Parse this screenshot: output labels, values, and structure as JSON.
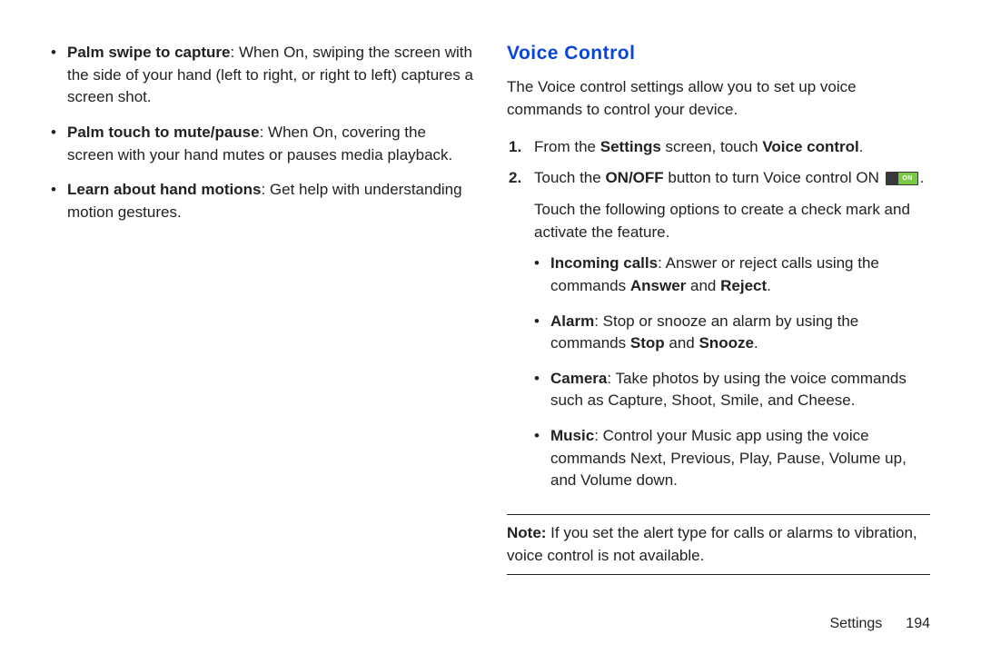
{
  "left": {
    "bullets": [
      {
        "title": "Palm swipe to capture",
        "text": ": When On, swiping the screen with the side of your hand (left to right, or right to left) captures a screen shot."
      },
      {
        "title": "Palm touch to mute/pause",
        "text": ": When On, covering the screen with your hand mutes or pauses media playback."
      },
      {
        "title": "Learn about hand motions",
        "text": ": Get help with understanding motion gestures."
      }
    ]
  },
  "right": {
    "heading": "Voice Control",
    "intro": "The Voice control settings allow you to set up voice commands to control your device.",
    "steps": [
      {
        "pre": "From the ",
        "bold1": "Settings",
        "mid": " screen, touch ",
        "bold2": "Voice control",
        "post": "."
      },
      {
        "pre": "Touch the ",
        "bold1": "ON/OFF",
        "mid": " button to turn Voice control ON ",
        "toggle": true,
        "post": "."
      }
    ],
    "toggleLabel": "ON",
    "subInstr": "Touch the following options to create a check mark and activate the feature.",
    "options": [
      {
        "title": "Incoming calls",
        "text": ": Answer or reject calls using the commands ",
        "bold1": "Answer",
        "mid": " and ",
        "bold2": "Reject",
        "post": "."
      },
      {
        "title": "Alarm",
        "text": ": Stop or snooze an alarm by using the commands ",
        "bold1": "Stop",
        "mid": " and ",
        "bold2": "Snooze",
        "post": "."
      },
      {
        "title": "Camera",
        "text": ": Take photos by using the voice commands such as Capture, Shoot, Smile, and Cheese."
      },
      {
        "title": "Music",
        "text": ": Control your Music app using the voice commands Next, Previous, Play, Pause, Volume up, and Volume down."
      }
    ],
    "noteLabel": "Note:",
    "noteText": " If you set the alert type for calls or alarms to vibration, voice control is not available."
  },
  "footer": {
    "sectionName": "Settings",
    "pageNumber": "194"
  }
}
